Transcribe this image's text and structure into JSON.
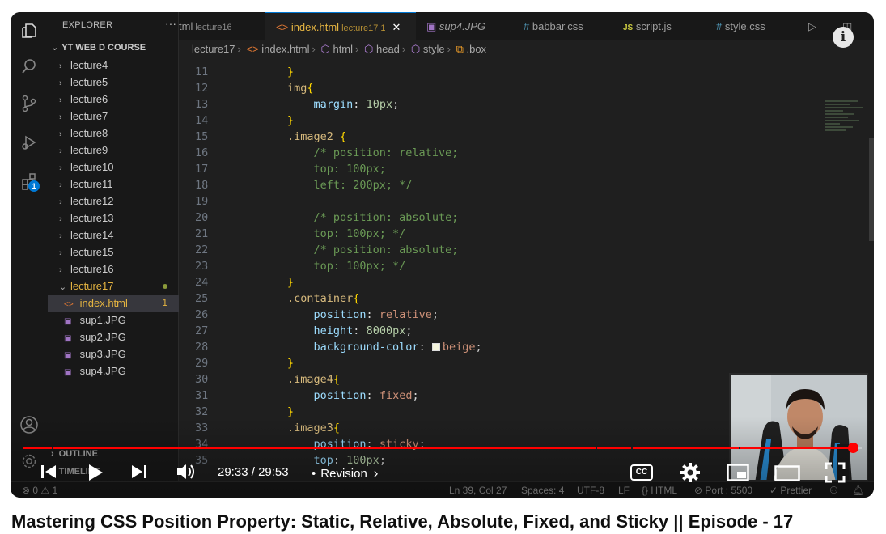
{
  "explorer": {
    "header": "EXPLORER",
    "more": "···",
    "root": "YT WEB D COURSE",
    "folders": [
      "lecture4",
      "lecture5",
      "lecture6",
      "lecture7",
      "lecture8",
      "lecture9",
      "lecture10",
      "lecture11",
      "lecture12",
      "lecture13",
      "lecture14",
      "lecture15",
      "lecture16"
    ],
    "open_folder": "lecture17",
    "files": [
      {
        "name": "index.html",
        "badge": "1",
        "active": true,
        "icon": "html-icon"
      },
      {
        "name": "sup1.JPG",
        "icon": "image-icon"
      },
      {
        "name": "sup2.JPG",
        "icon": "image-icon"
      },
      {
        "name": "sup3.JPG",
        "icon": "image-icon"
      },
      {
        "name": "sup4.JPG",
        "icon": "image-icon"
      }
    ],
    "outline": "OUTLINE",
    "timeline": "TIMELINE",
    "extensions_badge": "1"
  },
  "tabs": [
    {
      "label": "tml",
      "sub": "lecture16"
    },
    {
      "label": "index.html",
      "sub": "lecture17 1",
      "active": true
    },
    {
      "label": "sup4.JPG"
    },
    {
      "label": "babbar.css"
    },
    {
      "label": "script.js"
    },
    {
      "label": "style.css"
    }
  ],
  "breadcrumb": [
    "lecture17",
    "index.html",
    "html",
    "head",
    "style",
    ".box"
  ],
  "code": {
    "line_numbers": [
      "11",
      "12",
      "13",
      "14",
      "15",
      "16",
      "17",
      "18",
      "19",
      "20",
      "21",
      "22",
      "23",
      "24",
      "25",
      "26",
      "27",
      "28",
      "29",
      "30",
      "31",
      "32",
      "33",
      "34",
      "35"
    ],
    "l11": "}",
    "l12_sel": "img",
    "l13_prop": "margin",
    "l13_val": "10px",
    "l14": "}",
    "l15_sel": ".image2",
    "l16": "/* position: relative;",
    "l17": "top: 100px;",
    "l18": "left: 200px; */",
    "l20": "/* position: absolute;",
    "l21": "top: 100px; */",
    "l22": "/* position: absolute;",
    "l23": "top: 100px; */",
    "l24": "}",
    "l25_sel": ".container",
    "l26_prop": "position",
    "l26_val": "relative",
    "l27_prop": "height",
    "l27_val": "8000px",
    "l28_prop": "background-color",
    "l28_val": "beige",
    "l29": "}",
    "l30_sel": ".image4",
    "l31_prop": "position",
    "l31_val": "fixed",
    "l32": "}",
    "l33_sel": ".image3",
    "l34_prop": "position",
    "l34_val": "sticky",
    "l35_prop": "top",
    "l35_val": "100px"
  },
  "statusbar": {
    "problems": "⊗ 0 ⚠ 1",
    "cursor": "Ln 39, Col 27",
    "spaces": "Spaces: 4",
    "encoding": "UTF-8",
    "eol": "LF",
    "language": "{} HTML",
    "port": "⊘ Port : 5500",
    "prettier": "✓ Prettier"
  },
  "video": {
    "current_time": "29:33",
    "duration": "29:53",
    "time_separator": "/",
    "chapter": "Revision",
    "progress_fraction": 0.989,
    "chapter_marks": [
      0.035,
      0.683,
      0.725,
      0.853
    ],
    "title": "Mastering CSS Position Property: Static, Relative, Absolute, Fixed, and Sticky || Episode - 17",
    "cc_label": "CC",
    "info_label": "i"
  },
  "colors": {
    "progress": "#ff0000",
    "accent_yellow": "#e3b341",
    "vscode_blue": "#0078d4"
  }
}
